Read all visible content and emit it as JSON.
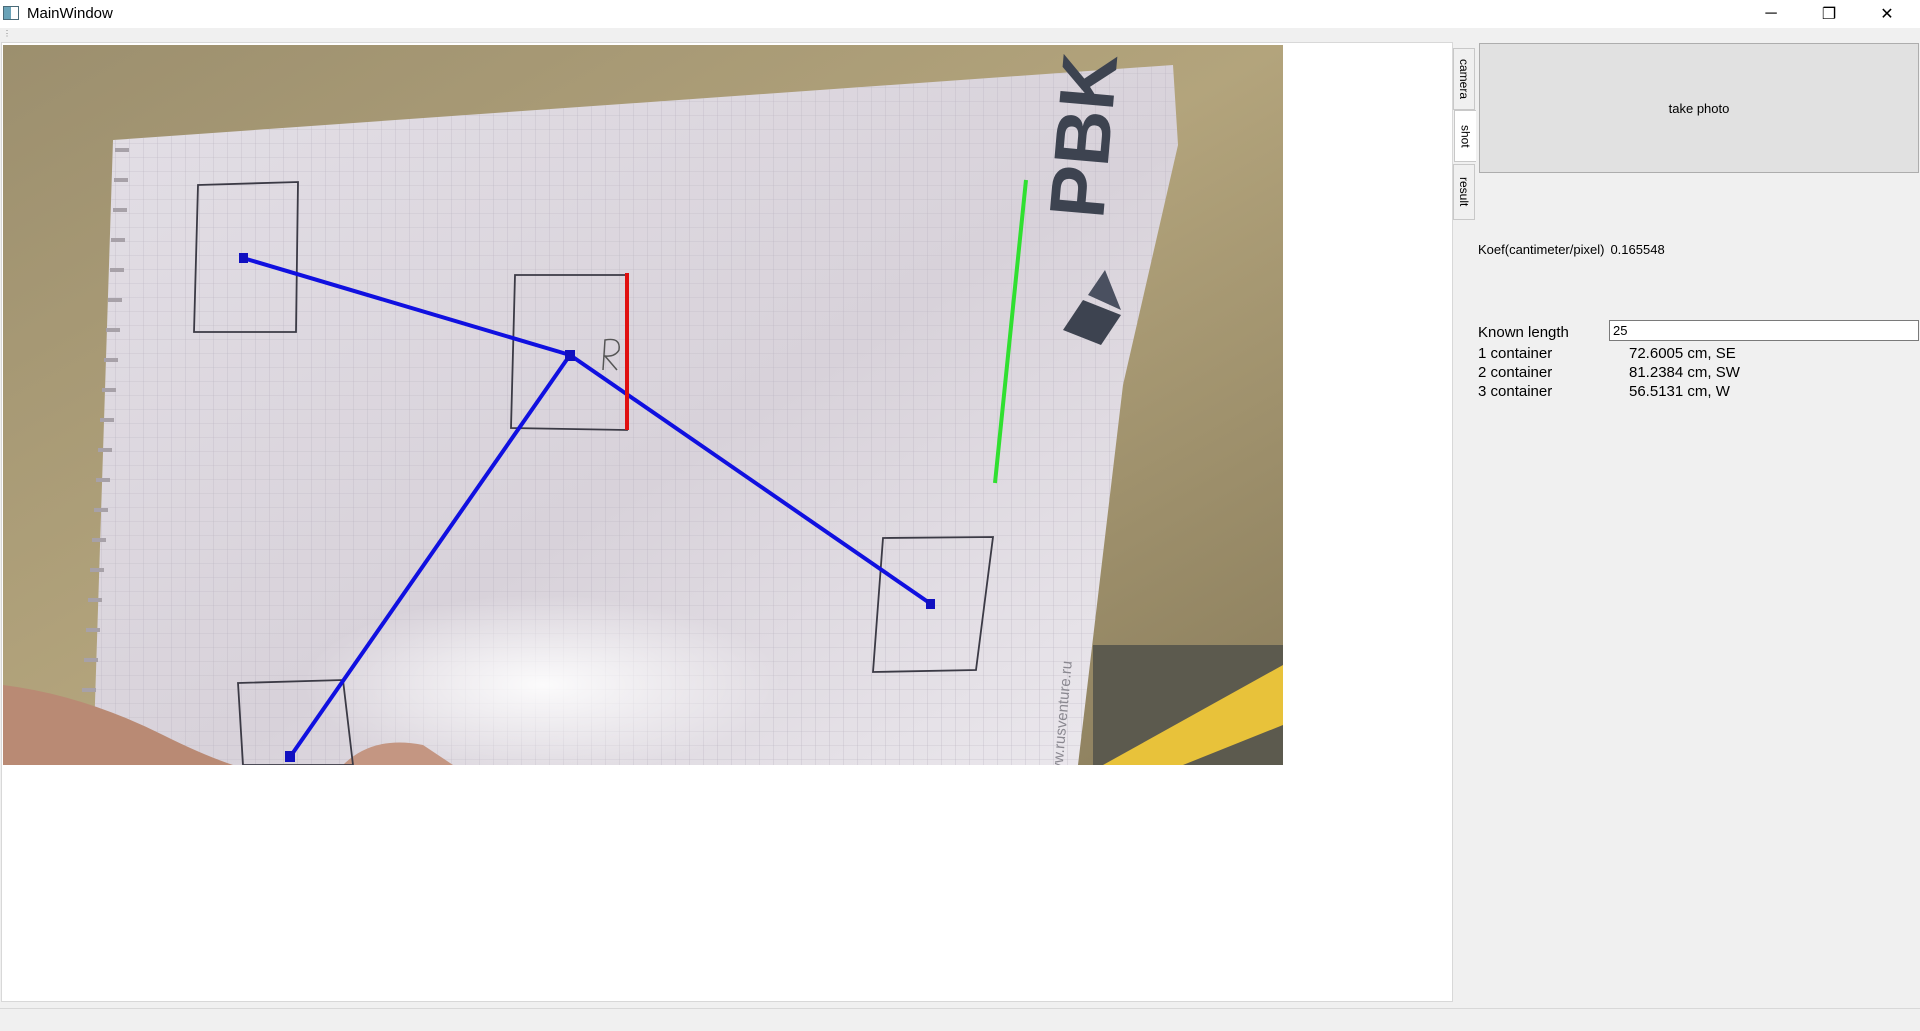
{
  "window": {
    "title": "MainWindow",
    "controls": {
      "minimize": "─",
      "maximize": "❐",
      "close": "✕"
    }
  },
  "tabs": [
    {
      "label": "camera",
      "active": false
    },
    {
      "label": "shot",
      "active": true
    },
    {
      "label": "result",
      "active": false
    }
  ],
  "panel": {
    "take_photo_label": "take photo",
    "koef_label": "Koef(cantimeter/pixel)",
    "koef_value": "0.165548",
    "known_length_label": "Known length",
    "known_length_value": "25",
    "containers": [
      {
        "name": "1 container",
        "value": "72.6005 cm, SE"
      },
      {
        "name": "2 container",
        "value": "81.2384 cm, SW"
      },
      {
        "name": "3 container",
        "value": "56.5131 cm, W"
      }
    ]
  },
  "photo": {
    "logo_text": "PBK",
    "website_text": "www.rusventure.ru",
    "handwritten_label": "R",
    "colors": {
      "path_lines": "#1010e0",
      "reference_line": "#e01010",
      "measure_line": "#30e030"
    }
  }
}
